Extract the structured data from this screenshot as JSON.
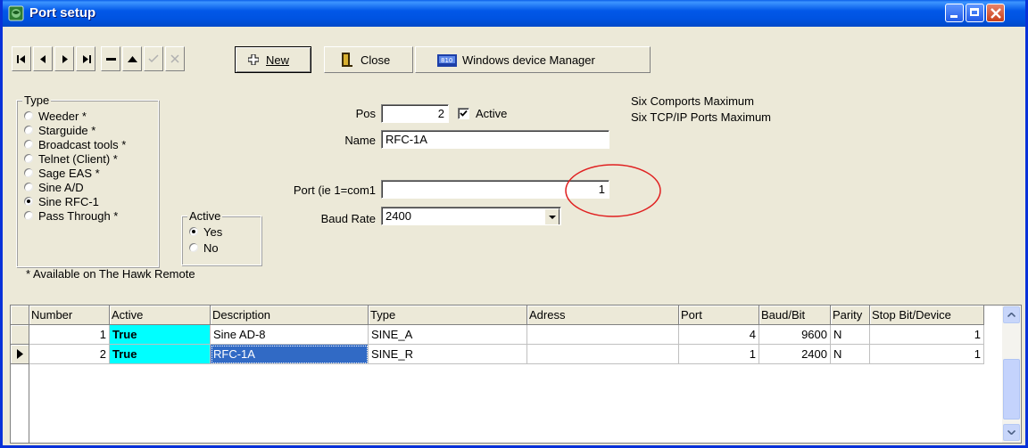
{
  "window": {
    "title": "Port setup"
  },
  "toolbar": {
    "new_label": "New",
    "close_label": "Close",
    "device_manager_label": "Windows device Manager"
  },
  "type_group": {
    "title": "Type",
    "options": [
      {
        "label": "Weeder *",
        "selected": false
      },
      {
        "label": "Starguide *",
        "selected": false
      },
      {
        "label": "Broadcast tools *",
        "selected": false
      },
      {
        "label": "Telnet (Client) *",
        "selected": false
      },
      {
        "label": "Sage EAS *",
        "selected": false
      },
      {
        "label": "Sine A/D",
        "selected": false
      },
      {
        "label": "Sine RFC-1",
        "selected": true
      },
      {
        "label": "Pass Through *",
        "selected": false
      }
    ],
    "footnote": "* Available on The Hawk Remote"
  },
  "active_group": {
    "title": "Active",
    "options": [
      {
        "label": "Yes",
        "selected": true
      },
      {
        "label": "No",
        "selected": false
      }
    ]
  },
  "form": {
    "pos_label": "Pos",
    "pos_value": "2",
    "active_label": "Active",
    "active_checked": true,
    "name_label": "Name",
    "name_value": "RFC-1A",
    "port_label": "Port (ie 1=com1",
    "port_value": "1",
    "baud_label": "Baud Rate",
    "baud_value": "2400"
  },
  "info": {
    "line1": "Six Comports Maximum",
    "line2": "Six TCP/IP Ports Maximum"
  },
  "grid": {
    "columns": [
      "Number",
      "Active",
      "Description",
      "Type",
      "Adress",
      "Port",
      "Baud/Bit",
      "Parity",
      "Stop Bit/Device"
    ],
    "rows": [
      [
        "1",
        "True",
        "Sine AD-8",
        "SINE_A",
        "",
        "4",
        "9600",
        "N",
        "1"
      ],
      [
        "2",
        "True",
        "RFC-1A",
        "SINE_R",
        "",
        "1",
        "2400",
        "N",
        "1"
      ]
    ],
    "selected_row": 1
  },
  "colors": {
    "active_cell": "#00FFFF",
    "selection": "#316AC5",
    "annotation_circle": "#E02020"
  }
}
